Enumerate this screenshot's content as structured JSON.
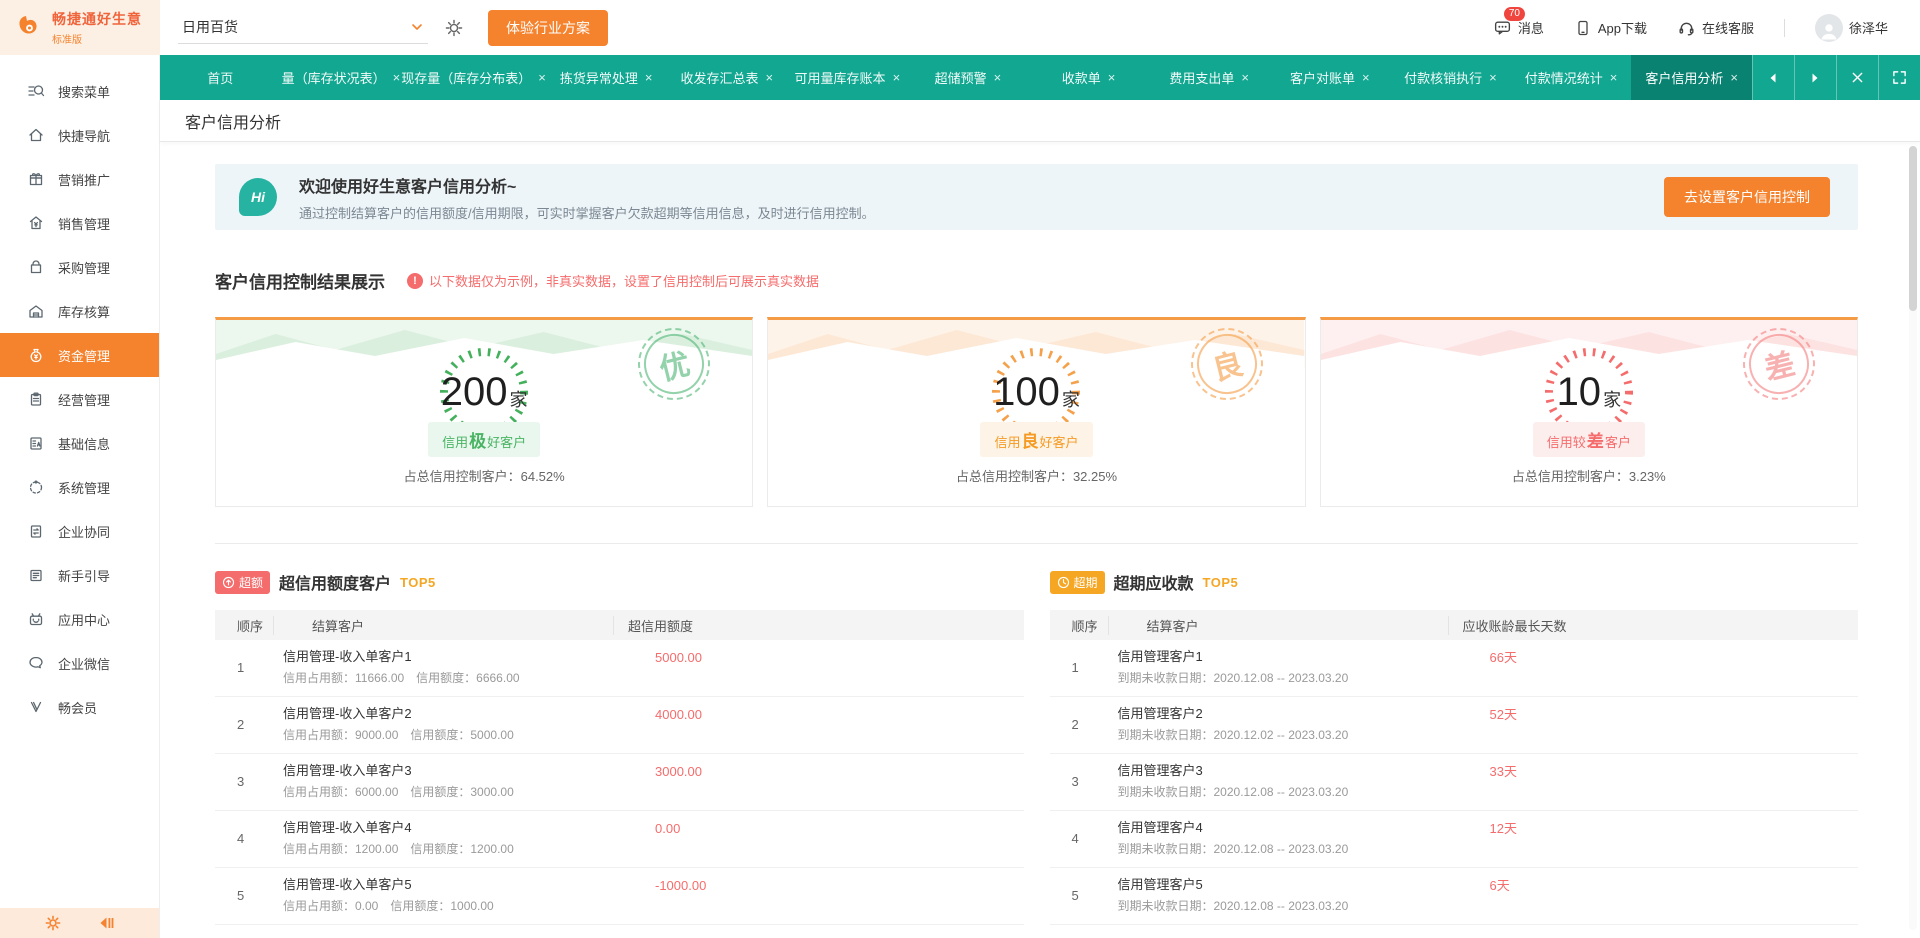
{
  "colors": {
    "teal": "#11a791",
    "teal_dark": "#0a8271",
    "accent_orange": "#f5822d",
    "badge_orange": "#f5a623",
    "alert_red": "#f56c6c",
    "good_green": "#43b05c"
  },
  "header": {
    "logo_title": "畅捷通好生意",
    "logo_subtitle": "标准版",
    "industry_value": "日用百货",
    "trial_button": "体验行业方案",
    "messages_label": "消息",
    "messages_badge": "70",
    "app_download_label": "App下载",
    "online_service_label": "在线客服",
    "username": "徐泽华"
  },
  "tabbar": {
    "close_icon": "×",
    "tabs": [
      {
        "label": "首页"
      },
      {
        "label": "量（库存状况表）"
      },
      {
        "label": "现存量（库存分布表）"
      },
      {
        "label": "拣货异常处理"
      },
      {
        "label": "收发存汇总表"
      },
      {
        "label": "可用量库存账本"
      },
      {
        "label": "超储预警"
      },
      {
        "label": "收款单"
      },
      {
        "label": "费用支出单"
      },
      {
        "label": "客户对账单"
      },
      {
        "label": "付款核销执行"
      },
      {
        "label": "付款情况统计"
      },
      {
        "label": "客户信用分析",
        "active": true
      }
    ]
  },
  "sidebar": {
    "items": [
      {
        "label": "搜索菜单",
        "icon": "search-icon"
      },
      {
        "label": "快捷导航",
        "icon": "home-icon"
      },
      {
        "label": "营销推广",
        "icon": "gift-icon"
      },
      {
        "label": "销售管理",
        "icon": "sales-icon"
      },
      {
        "label": "采购管理",
        "icon": "purchase-bag-icon"
      },
      {
        "label": "库存核算",
        "icon": "warehouse-icon"
      },
      {
        "label": "资金管理",
        "icon": "money-bag-icon",
        "active": true
      },
      {
        "label": "经营管理",
        "icon": "clipboard-icon"
      },
      {
        "label": "基础信息",
        "icon": "base-info-icon"
      },
      {
        "label": "系统管理",
        "icon": "system-icon"
      },
      {
        "label": "企业协同",
        "icon": "collaboration-icon"
      },
      {
        "label": "新手引导",
        "icon": "guide-icon"
      },
      {
        "label": "应用中心",
        "icon": "app-center-icon"
      },
      {
        "label": "企业微信",
        "icon": "wechat-icon"
      },
      {
        "label": "畅会员",
        "icon": "member-icon"
      }
    ]
  },
  "page": {
    "title": "客户信用分析",
    "banner": {
      "hi": "Hi",
      "title": "欢迎使用好生意客户信用分析~",
      "desc": "通过控制结算客户的信用额度/信用期限，可实时掌握客户欠款超期等信用信息，及时进行信用控制。",
      "button": "去设置客户信用控制"
    },
    "section_title": "客户信用控制结果展示",
    "section_warning": "以下数据仅为示例，非真实数据，设置了信用控制后可展示真实数据",
    "cards": [
      {
        "count": "200",
        "unit": "家",
        "badge_pre": "信用",
        "badge_big": "极",
        "badge_post": "好客户",
        "percent_text": "占总信用控制客户：64.52%",
        "stamp": "优",
        "theme_color": "#43b05c"
      },
      {
        "count": "100",
        "unit": "家",
        "badge_pre": "信用",
        "badge_big": "良",
        "badge_post": "好客户",
        "percent_text": "占总信用控制客户：32.25%",
        "stamp": "良",
        "theme_color": "#f5a04a"
      },
      {
        "count": "10",
        "unit": "家",
        "badge_pre": "信用较",
        "badge_big": "差",
        "badge_post": "客户",
        "percent_text": "占总信用控制客户：3.23%",
        "stamp": "差",
        "theme_color": "#f56c6c"
      }
    ],
    "tables": [
      {
        "badge": "超额",
        "title": "超信用额度客户",
        "top_label": "TOP5",
        "headers": [
          "顺序",
          "结算客户",
          "超信用额度"
        ],
        "rows": [
          {
            "no": "1",
            "name": "信用管理-收入单客户1",
            "detail": "信用占用额：11666.00　信用额度：6666.00",
            "value": "5000.00"
          },
          {
            "no": "2",
            "name": "信用管理-收入单客户2",
            "detail": "信用占用额：9000.00　信用额度：5000.00",
            "value": "4000.00"
          },
          {
            "no": "3",
            "name": "信用管理-收入单客户3",
            "detail": "信用占用额：6000.00　信用额度：3000.00",
            "value": "3000.00"
          },
          {
            "no": "4",
            "name": "信用管理-收入单客户4",
            "detail": "信用占用额：1200.00　信用额度：1200.00",
            "value": "0.00"
          },
          {
            "no": "5",
            "name": "信用管理-收入单客户5",
            "detail": "信用占用额：0.00　信用额度：1000.00",
            "value": "-1000.00"
          }
        ]
      },
      {
        "badge": "超期",
        "title": "超期应收款",
        "top_label": "TOP5",
        "headers": [
          "顺序",
          "结算客户",
          "应收账龄最长天数"
        ],
        "rows": [
          {
            "no": "1",
            "name": "信用管理客户1",
            "detail": "到期未收款日期：2020.12.08 -- 2023.03.20",
            "value": "66天"
          },
          {
            "no": "2",
            "name": "信用管理客户2",
            "detail": "到期未收款日期：2020.12.02 -- 2023.03.20",
            "value": "52天"
          },
          {
            "no": "3",
            "name": "信用管理客户3",
            "detail": "到期未收款日期：2020.12.08 -- 2023.03.20",
            "value": "33天"
          },
          {
            "no": "4",
            "name": "信用管理客户4",
            "detail": "到期未收款日期：2020.12.08 -- 2023.03.20",
            "value": "12天"
          },
          {
            "no": "5",
            "name": "信用管理客户5",
            "detail": "到期未收款日期：2020.12.08 -- 2023.03.20",
            "value": "6天"
          }
        ]
      }
    ]
  }
}
